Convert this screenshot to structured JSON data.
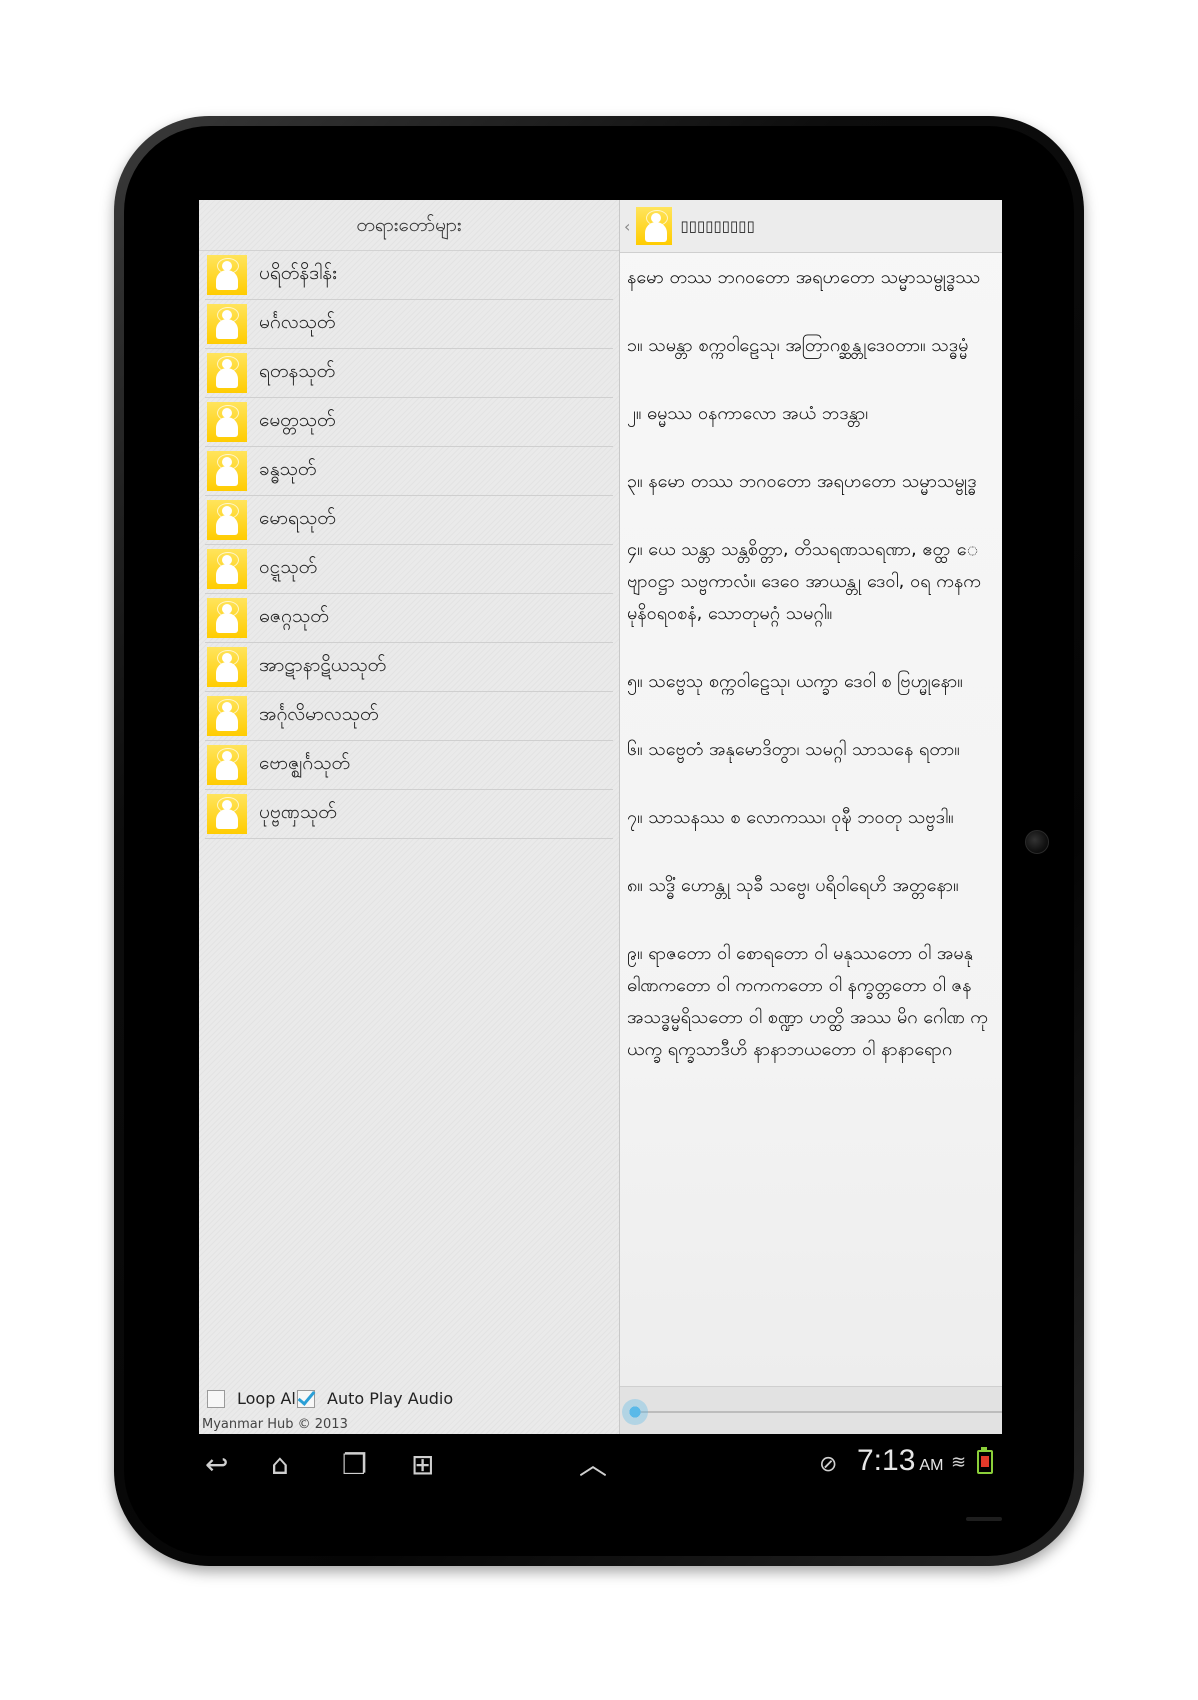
{
  "left_panel": {
    "title": "တရားတော်များ",
    "items": [
      {
        "label": "ပရိတ်နိဒါန်း"
      },
      {
        "label": "မင်္ဂလသုတ်"
      },
      {
        "label": "ရတနသုတ်"
      },
      {
        "label": "မေတ္တသုတ်"
      },
      {
        "label": "ခန္ဓသုတ်"
      },
      {
        "label": "မောရသုတ်"
      },
      {
        "label": "ဝဋ္ဋသုတ်"
      },
      {
        "label": "ဓဇဂ္ဂသုတ်"
      },
      {
        "label": "အာဋာနာဋိယသုတ်"
      },
      {
        "label": "အင်္ဂုလိမာလသုတ်"
      },
      {
        "label": "ဗောဇ္ဈင်္ဂသုတ်"
      },
      {
        "label": "ပုဗ္ဗဏှသုတ်"
      }
    ],
    "loop_all_label": "Loop All",
    "loop_all_checked": false,
    "auto_play_label": "Auto Play Audio",
    "auto_play_checked": true,
    "copyright": "Myanmar Hub © 2013"
  },
  "right_panel": {
    "back_glyph": "‹",
    "title": "▯▯▯▯▯▯▯▯▯",
    "paragraphs": [
      [
        "နမော တဿ ဘဂဝတော အရဟတော သမ္မာသမ္ဗုဒ္ဓဿ"
      ],
      [
        "၁။ သမန္တာ စက္ကဝါဠေသု၊ အတြာဂစ္ဆန္တုဒေဝတာ။ သဒ္ဓမ္မံ"
      ],
      [
        "၂။ ဓမ္မဿ ဝနကာလော အယံ ဘဒန္တာ၊"
      ],
      [
        "၃။ နမော တဿ ဘဂဝတော အရဟတော သမ္မာသမ္ဗုဒ္ဓ"
      ],
      [
        "၄။ ယေ သန္တာ သန္တစိတ္တာ, တိသရဏသရဏာ, ဧတ္ထ ေ",
        "ဗျာဝဋ္ဌာ သဗ္ဗကာလံ။ ဒေဝေ အာယန္တု ဒေဝါ, ဝရ ကနက",
        "မုနိဝရဝစနံ, သောတုမဂ္ဂံ သမဂ္ဂါ။"
      ],
      [
        "၅။ သဗ္ဗေသု စက္ကဝါဠေသု၊ ယက္ခာ ဒေဝါ စ ဗြဟ္မုနော။"
      ],
      [
        "၆။ သဗ္ဗေတံ အနုမောဒိတွာ၊ သမဂ္ဂါ သာသနေ ရတာ။"
      ],
      [
        "၇။ သာသနဿ စ လောကဿ၊ ဝုဍ္ဎီ ဘဝတု သဗ္ဗဒါ။"
      ],
      [
        "၈။ သဒ္ဓိံ ဟောန္တု သုခီ သဗ္ဗေ၊ ပရိဝါရေဟိ အတ္တနော။"
      ],
      [
        "၉။ ရာဇတော ဝါ စောရတော ဝါ မနုဿတော ဝါ အမနု",
        "ဓါဏကတော ဝါ ကကကတော ဝါ နက္ခတ္တတော ဝါ ဇန",
        "အသဒ္ဓမ္မရိသတော ဝါ စဏ္ဍာ ဟတ္ထိ အဿ မိဂ ဂေါဏ ကု",
        "ယက္ခ ရက္ခသာဒီဟိ နာနာဘယတော ဝါ နာနာရောဂ"
      ]
    ],
    "audio_progress": 0.0
  },
  "system_bar": {
    "back_glyph": "↩",
    "home_glyph": "⌂",
    "recents_glyph": "❐",
    "apps_glyph": "⊞",
    "up_glyph": "︿",
    "clock": "7:13",
    "ampm": "AM"
  }
}
